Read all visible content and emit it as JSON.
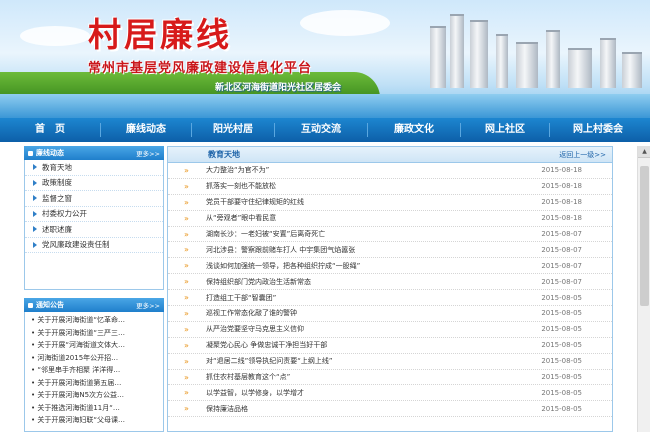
{
  "banner": {
    "title": "村居廉线",
    "subtitle": "常州市基层党风廉政建设信息化平台",
    "org": "新北区河海街道阳光社区居委会"
  },
  "nav": [
    "首　页",
    "廉线动态",
    "阳光村居",
    "互动交流",
    "廉政文化",
    "网上社区",
    "网上村委会"
  ],
  "sidebar": {
    "header": "廉线动态",
    "more": "更多>>",
    "items": [
      "教育天地",
      "政策制度",
      "监督之窗",
      "村委权力公开",
      "述职述廉",
      "党风廉政建设责任制"
    ]
  },
  "notices": {
    "header": "通知公告",
    "more": "更多>>",
    "items": [
      "• 关于开展河海街道“忆革命…",
      "• 关于开展河海街道“三严三…",
      "• 关于开展“河海街道文体大…",
      "• 河海街道2015年公开招…",
      "• “邻里串手齐相聚 洋洋得…",
      "• 关于开展河海街道第五届…",
      "• 关于开展河海N5次方公益…",
      "• 关于推选河海街道11月“…",
      "• 关于开展河海妇联“父母课…"
    ]
  },
  "main": {
    "header": "教育天地",
    "back": "返回上一级>>",
    "rows": [
      {
        "title": "大力整治“为官不为”",
        "date": "2015-08-18"
      },
      {
        "title": "抓落实一刻也不能放松",
        "date": "2015-08-18"
      },
      {
        "title": "党员干部要守住纪律规矩的红线",
        "date": "2015-08-18"
      },
      {
        "title": "从“旁观者”眼中看民意",
        "date": "2015-08-18"
      },
      {
        "title": "湖南长沙：一老妇被“安置”后离奇死亡",
        "date": "2015-08-07"
      },
      {
        "title": "河北涉县：警察跟前赌车打人 中宇集团气焰嚣张",
        "date": "2015-08-07"
      },
      {
        "title": "浅谈如何加强统一领导，把各种组织拧成“一股绳”",
        "date": "2015-08-07"
      },
      {
        "title": "保持组织部门党内政治生活新常态",
        "date": "2015-08-07"
      },
      {
        "title": "打造组工干部“智囊团”",
        "date": "2015-08-05"
      },
      {
        "title": "巡视工作常态化敲了谁的警钟",
        "date": "2015-08-05"
      },
      {
        "title": "从严治党要坚守马克思主义信仰",
        "date": "2015-08-05"
      },
      {
        "title": "凝聚党心民心 争做忠诚干净担当好干部",
        "date": "2015-08-05"
      },
      {
        "title": "对“退居二线”领导执纪问责要“上纲上线”",
        "date": "2015-08-05"
      },
      {
        "title": "抓住农村基层教育这个“点”",
        "date": "2015-08-05"
      },
      {
        "title": "以学益智，以学修身，以学增才",
        "date": "2015-08-05"
      },
      {
        "title": "保持廉洁品格",
        "date": "2015-08-05"
      }
    ]
  }
}
